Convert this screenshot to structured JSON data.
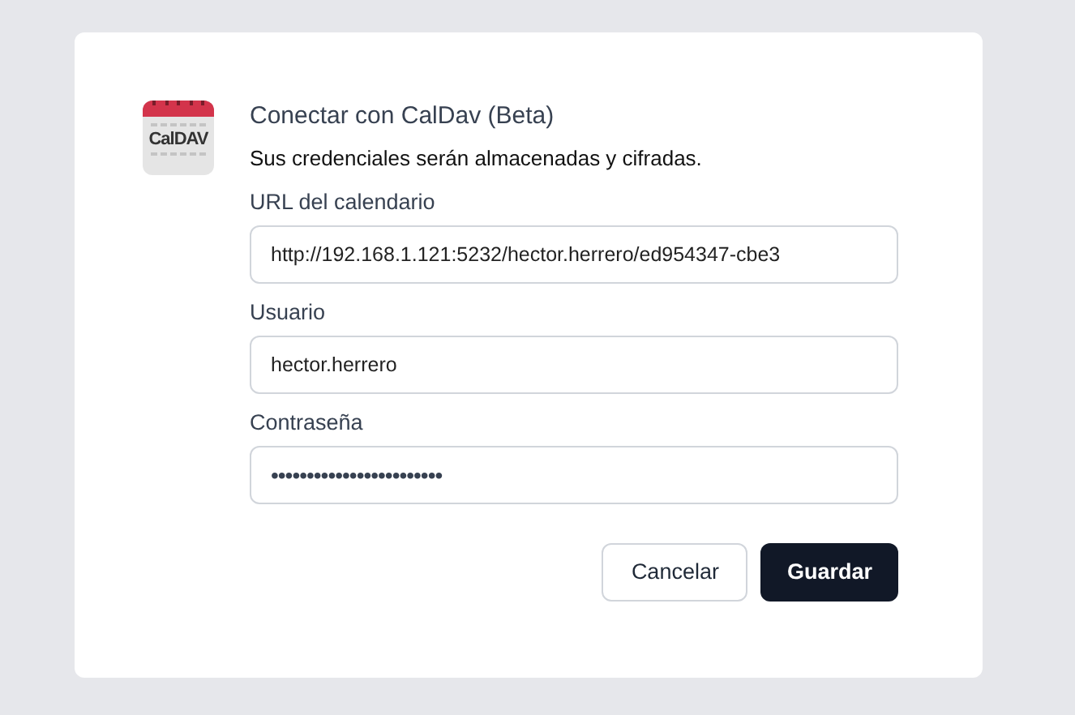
{
  "dialog": {
    "logo_text": "CalDAV",
    "title": "Conectar con CalDav (Beta)",
    "subtitle": "Sus credenciales serán almacenadas y cifradas.",
    "fields": [
      {
        "label": "URL del calendario",
        "value": "http://192.168.1.121:5232/hector.herrero/ed954347-cbe3",
        "kind": "text"
      },
      {
        "label": "Usuario",
        "value": "hector.herrero",
        "kind": "text"
      },
      {
        "label": "Contraseña",
        "value": "••••••••••••••••••••••••",
        "kind": "password"
      }
    ],
    "buttons": [
      {
        "label": "Cancelar",
        "kind": "secondary"
      },
      {
        "label": "Guardar",
        "kind": "primary"
      }
    ]
  }
}
